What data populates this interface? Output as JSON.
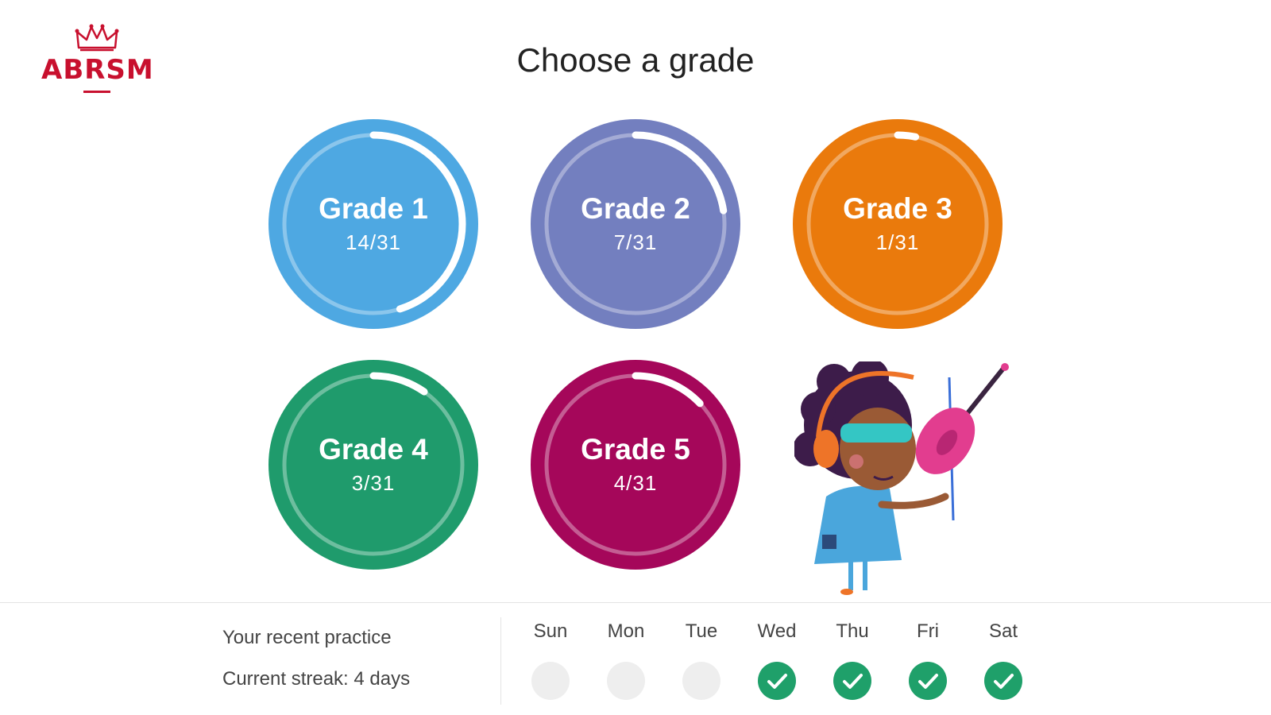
{
  "brand": {
    "name": "ABRSM",
    "color": "#c8102e",
    "icon": "crown-icon"
  },
  "page": {
    "title": "Choose a grade"
  },
  "grades": [
    {
      "label": "Grade 1",
      "progress": "14/31",
      "completed": 14,
      "total": 31,
      "color": "#4ea8e2"
    },
    {
      "label": "Grade 2",
      "progress": "7/31",
      "completed": 7,
      "total": 31,
      "color": "#737fbf"
    },
    {
      "label": "Grade 3",
      "progress": "1/31",
      "completed": 1,
      "total": 31,
      "color": "#ea7a0c"
    },
    {
      "label": "Grade 4",
      "progress": "3/31",
      "completed": 3,
      "total": 31,
      "color": "#1f9b6c"
    },
    {
      "label": "Grade 5",
      "progress": "4/31",
      "completed": 4,
      "total": 31,
      "color": "#a5075a"
    }
  ],
  "practice": {
    "label": "Your recent practice",
    "streak": "Current streak: 4 days",
    "days": [
      {
        "name": "Sun",
        "done": false
      },
      {
        "name": "Mon",
        "done": false
      },
      {
        "name": "Tue",
        "done": false
      },
      {
        "name": "Wed",
        "done": true
      },
      {
        "name": "Thu",
        "done": true
      },
      {
        "name": "Fri",
        "done": true
      },
      {
        "name": "Sat",
        "done": true
      }
    ],
    "done_color": "#1fa06a",
    "check_icon": "checkmark-icon"
  },
  "illustration": {
    "name": "violinist-girl-illustration"
  }
}
